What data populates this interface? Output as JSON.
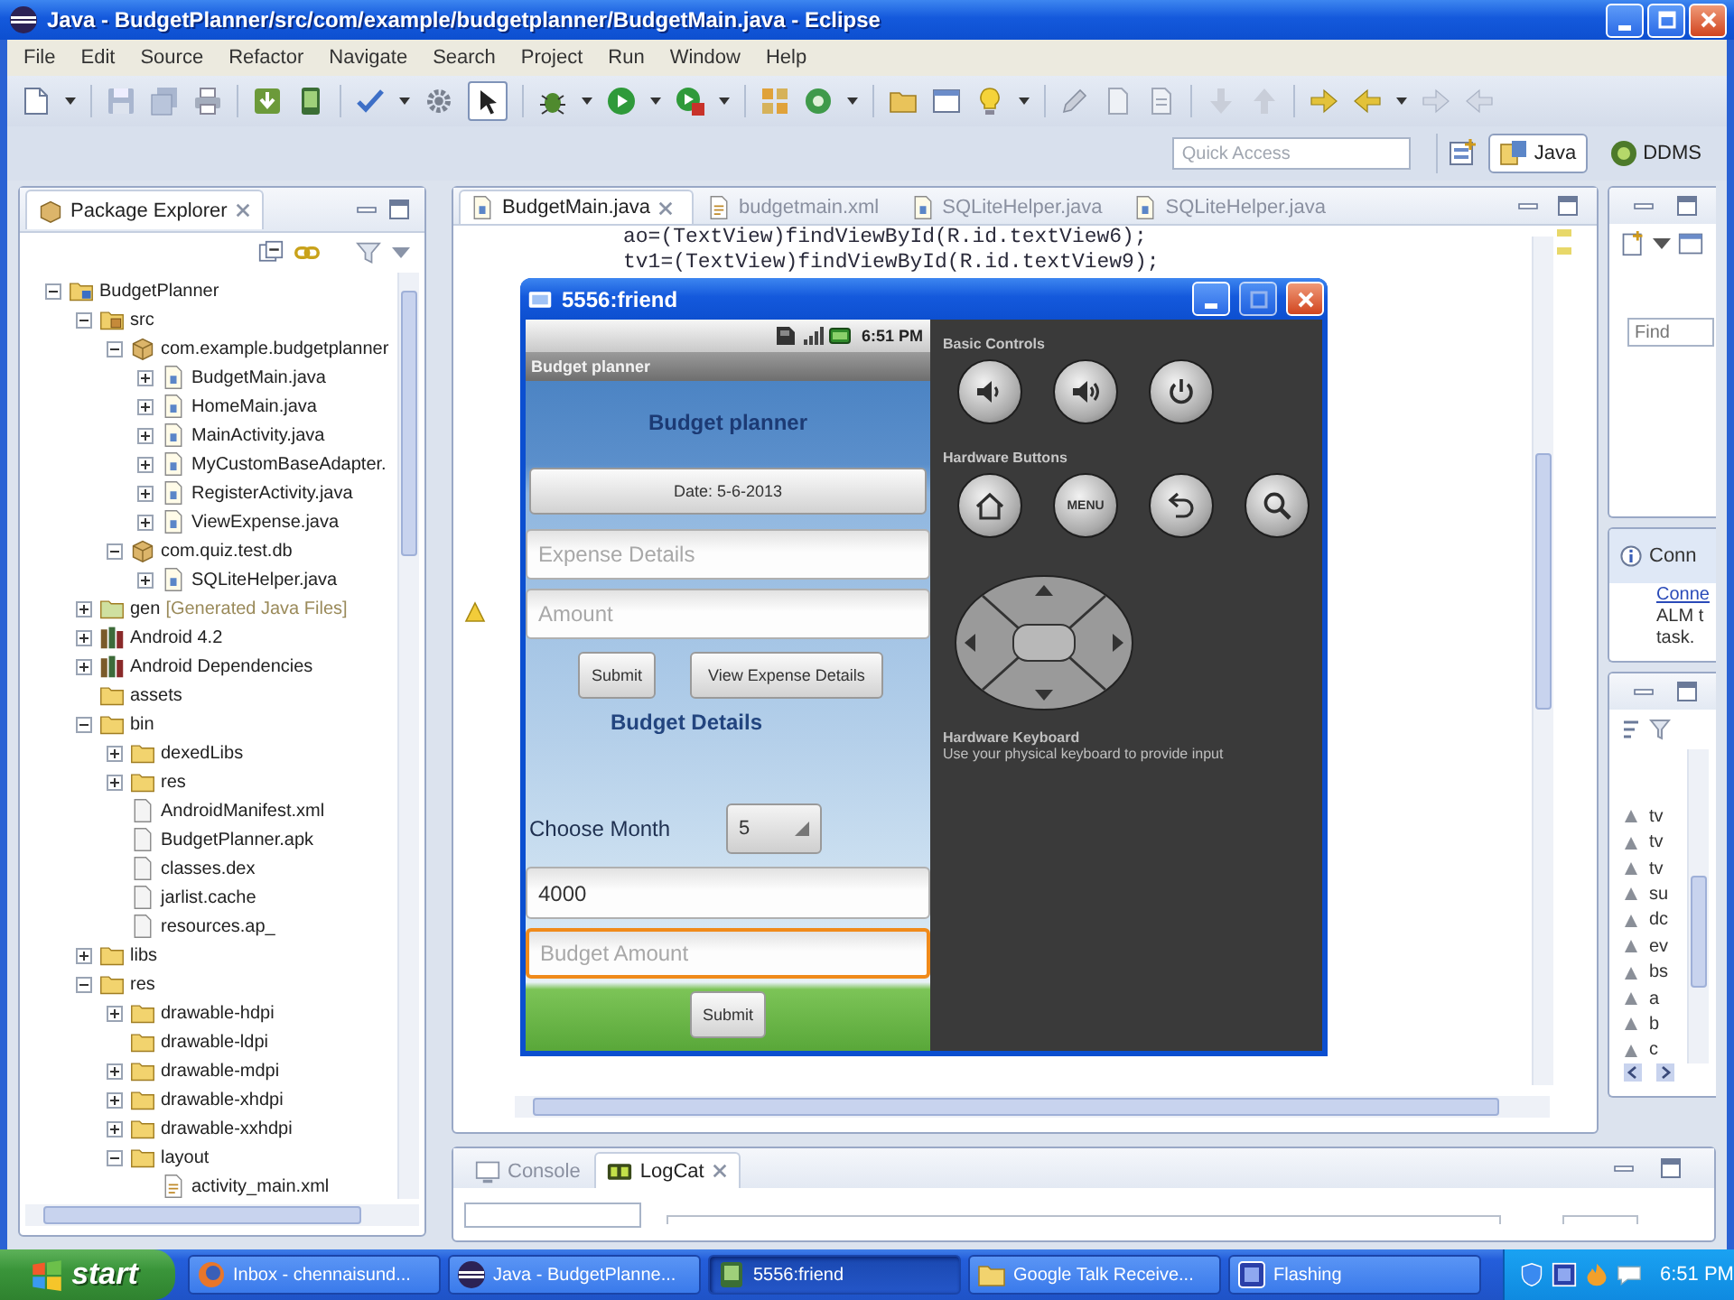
{
  "window": {
    "title": "Java - BudgetPlanner/src/com/example/budgetplanner/BudgetMain.java - Eclipse"
  },
  "menu_bar": [
    "File",
    "Edit",
    "Source",
    "Refactor",
    "Navigate",
    "Search",
    "Project",
    "Run",
    "Window",
    "Help"
  ],
  "toolbar": {
    "quick_access": {
      "placeholder": "Quick Access"
    },
    "perspectives": [
      {
        "label": "Java",
        "kind": "java",
        "selected": true
      },
      {
        "label": "DDMS",
        "kind": "ddms",
        "selected": false
      }
    ]
  },
  "package_explorer": {
    "title": "Package Explorer",
    "tree": [
      {
        "label": "BudgetPlanner",
        "kind": "project",
        "expanded": true,
        "children": [
          {
            "label": "src",
            "kind": "source",
            "expanded": true,
            "children": [
              {
                "label": "com.example.budgetplanner",
                "kind": "package",
                "expanded": true,
                "children": [
                  {
                    "label": "BudgetMain.java",
                    "kind": "java",
                    "expanded": false
                  },
                  {
                    "label": "HomeMain.java",
                    "kind": "java",
                    "expanded": false
                  },
                  {
                    "label": "MainActivity.java",
                    "kind": "java",
                    "expanded": false
                  },
                  {
                    "label": "MyCustomBaseAdapter.",
                    "kind": "java",
                    "expanded": false
                  },
                  {
                    "label": "RegisterActivity.java",
                    "kind": "java",
                    "expanded": false
                  },
                  {
                    "label": "ViewExpense.java",
                    "kind": "java",
                    "expanded": false
                  }
                ]
              },
              {
                "label": "com.quiz.test.db",
                "kind": "package",
                "expanded": true,
                "children": [
                  {
                    "label": "SQLiteHelper.java",
                    "kind": "java",
                    "expanded": false
                  }
                ]
              }
            ]
          },
          {
            "label": "gen",
            "decoration": "[Generated Java Files]",
            "kind": "generated",
            "expanded": false
          },
          {
            "label": "Android 4.2",
            "kind": "library",
            "expanded": false
          },
          {
            "label": "Android Dependencies",
            "kind": "library",
            "expanded": false
          },
          {
            "label": "assets",
            "kind": "folder"
          },
          {
            "label": "bin",
            "kind": "folder",
            "expanded": true,
            "children": [
              {
                "label": "dexedLibs",
                "kind": "folder",
                "expanded": false
              },
              {
                "label": "res",
                "kind": "folder",
                "expanded": false
              },
              {
                "label": "AndroidManifest.xml",
                "kind": "file"
              },
              {
                "label": "BudgetPlanner.apk",
                "kind": "file"
              },
              {
                "label": "classes.dex",
                "kind": "file"
              },
              {
                "label": "jarlist.cache",
                "kind": "file"
              },
              {
                "label": "resources.ap_",
                "kind": "file"
              }
            ]
          },
          {
            "label": "libs",
            "kind": "folder",
            "expanded": false
          },
          {
            "label": "res",
            "kind": "folder",
            "expanded": true,
            "children": [
              {
                "label": "drawable-hdpi",
                "kind": "folder",
                "expanded": false
              },
              {
                "label": "drawable-ldpi",
                "kind": "folder"
              },
              {
                "label": "drawable-mdpi",
                "kind": "folder",
                "expanded": false
              },
              {
                "label": "drawable-xhdpi",
                "kind": "folder",
                "expanded": false
              },
              {
                "label": "drawable-xxhdpi",
                "kind": "folder",
                "expanded": false
              },
              {
                "label": "layout",
                "kind": "folder",
                "expanded": true,
                "children": [
                  {
                    "label": "activity_main.xml",
                    "kind": "xml"
                  }
                ]
              }
            ]
          }
        ]
      }
    ]
  },
  "editor": {
    "tabs": [
      {
        "label": "BudgetMain.java",
        "kind": "java",
        "selected": true
      },
      {
        "label": "budgetmain.xml",
        "kind": "xml",
        "selected": false
      },
      {
        "label": "SQLiteHelper.java",
        "kind": "java",
        "selected": false
      },
      {
        "label": "SQLiteHelper.java",
        "kind": "java",
        "selected": false
      }
    ],
    "code_lines": [
      "ao=(TextView)findViewById(R.id.textView6);",
      "tv1=(TextView)findViewById(R.id.textView9);"
    ]
  },
  "task_panel": {
    "find_field": {
      "placeholder": "Find"
    },
    "connect_title": "Conn",
    "connect_link": "Conne",
    "connect_lines": [
      "ALM t",
      "task."
    ]
  },
  "outline_panel": {
    "items": [
      "tv",
      "tv",
      "tv",
      "su",
      "dc",
      "ev",
      "bs",
      "a",
      "b",
      "c"
    ]
  },
  "emulator": {
    "title": "5556:friend",
    "phone": {
      "status_time": "6:51 PM",
      "app_title": "Budget planner",
      "heading": "Budget planner",
      "date_button": "Date: 5-6-2013",
      "expense_field": {
        "placeholder": "Expense Details"
      },
      "amount_field": {
        "placeholder": "Amount"
      },
      "buttons": [
        "Submit",
        "View Expense Details"
      ],
      "section_title": "Budget Details",
      "month_label": "Choose Month",
      "month_spinner": "5",
      "budget_field": {
        "value": "4000"
      },
      "budget_amount_field": {
        "placeholder": "Budget Amount",
        "focused": true
      },
      "submit_button": "Submit"
    },
    "controls": {
      "basic_label": "Basic Controls",
      "basic_buttons": [
        {
          "kind": "volume-down"
        },
        {
          "kind": "volume-up"
        },
        {
          "kind": "power"
        }
      ],
      "hardware_label": "Hardware Buttons",
      "hardware_buttons": [
        {
          "kind": "home"
        },
        {
          "kind": "menu",
          "label": "MENU"
        },
        {
          "kind": "back"
        },
        {
          "kind": "search"
        }
      ],
      "keyboard_title": "Hardware Keyboard",
      "keyboard_hint": "Use your physical keyboard to provide input"
    }
  },
  "bottom_panel": {
    "tabs": [
      {
        "label": "Console",
        "kind": "console",
        "selected": false
      },
      {
        "label": "LogCat",
        "kind": "logcat",
        "selected": true
      }
    ]
  },
  "taskbar": {
    "start": "start",
    "tasks": [
      {
        "label": "Inbox - chennaisund...",
        "kind": "browser",
        "selected": false
      },
      {
        "label": "Java - BudgetPlanne...",
        "kind": "eclipse",
        "selected": false
      },
      {
        "label": "5556:friend",
        "kind": "emulator",
        "selected": true
      },
      {
        "label": "Google Talk Receive...",
        "kind": "folder",
        "selected": false
      },
      {
        "label": "Flashing",
        "kind": "app",
        "selected": false
      }
    ],
    "clock": "6:51 PM"
  }
}
